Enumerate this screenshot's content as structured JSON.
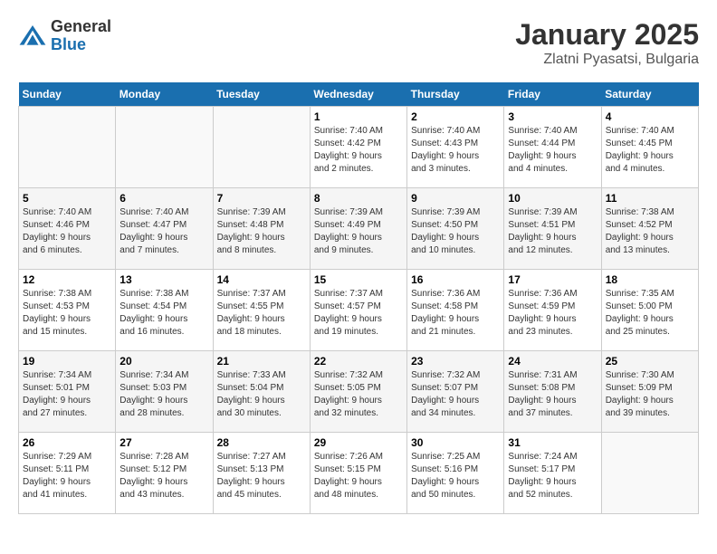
{
  "logo": {
    "general": "General",
    "blue": "Blue"
  },
  "header": {
    "month": "January 2025",
    "location": "Zlatni Pyasatsi, Bulgaria"
  },
  "weekdays": [
    "Sunday",
    "Monday",
    "Tuesday",
    "Wednesday",
    "Thursday",
    "Friday",
    "Saturday"
  ],
  "weeks": [
    [
      {
        "day": "",
        "info": ""
      },
      {
        "day": "",
        "info": ""
      },
      {
        "day": "",
        "info": ""
      },
      {
        "day": "1",
        "info": "Sunrise: 7:40 AM\nSunset: 4:42 PM\nDaylight: 9 hours\nand 2 minutes."
      },
      {
        "day": "2",
        "info": "Sunrise: 7:40 AM\nSunset: 4:43 PM\nDaylight: 9 hours\nand 3 minutes."
      },
      {
        "day": "3",
        "info": "Sunrise: 7:40 AM\nSunset: 4:44 PM\nDaylight: 9 hours\nand 4 minutes."
      },
      {
        "day": "4",
        "info": "Sunrise: 7:40 AM\nSunset: 4:45 PM\nDaylight: 9 hours\nand 4 minutes."
      }
    ],
    [
      {
        "day": "5",
        "info": "Sunrise: 7:40 AM\nSunset: 4:46 PM\nDaylight: 9 hours\nand 6 minutes."
      },
      {
        "day": "6",
        "info": "Sunrise: 7:40 AM\nSunset: 4:47 PM\nDaylight: 9 hours\nand 7 minutes."
      },
      {
        "day": "7",
        "info": "Sunrise: 7:39 AM\nSunset: 4:48 PM\nDaylight: 9 hours\nand 8 minutes."
      },
      {
        "day": "8",
        "info": "Sunrise: 7:39 AM\nSunset: 4:49 PM\nDaylight: 9 hours\nand 9 minutes."
      },
      {
        "day": "9",
        "info": "Sunrise: 7:39 AM\nSunset: 4:50 PM\nDaylight: 9 hours\nand 10 minutes."
      },
      {
        "day": "10",
        "info": "Sunrise: 7:39 AM\nSunset: 4:51 PM\nDaylight: 9 hours\nand 12 minutes."
      },
      {
        "day": "11",
        "info": "Sunrise: 7:38 AM\nSunset: 4:52 PM\nDaylight: 9 hours\nand 13 minutes."
      }
    ],
    [
      {
        "day": "12",
        "info": "Sunrise: 7:38 AM\nSunset: 4:53 PM\nDaylight: 9 hours\nand 15 minutes."
      },
      {
        "day": "13",
        "info": "Sunrise: 7:38 AM\nSunset: 4:54 PM\nDaylight: 9 hours\nand 16 minutes."
      },
      {
        "day": "14",
        "info": "Sunrise: 7:37 AM\nSunset: 4:55 PM\nDaylight: 9 hours\nand 18 minutes."
      },
      {
        "day": "15",
        "info": "Sunrise: 7:37 AM\nSunset: 4:57 PM\nDaylight: 9 hours\nand 19 minutes."
      },
      {
        "day": "16",
        "info": "Sunrise: 7:36 AM\nSunset: 4:58 PM\nDaylight: 9 hours\nand 21 minutes."
      },
      {
        "day": "17",
        "info": "Sunrise: 7:36 AM\nSunset: 4:59 PM\nDaylight: 9 hours\nand 23 minutes."
      },
      {
        "day": "18",
        "info": "Sunrise: 7:35 AM\nSunset: 5:00 PM\nDaylight: 9 hours\nand 25 minutes."
      }
    ],
    [
      {
        "day": "19",
        "info": "Sunrise: 7:34 AM\nSunset: 5:01 PM\nDaylight: 9 hours\nand 27 minutes."
      },
      {
        "day": "20",
        "info": "Sunrise: 7:34 AM\nSunset: 5:03 PM\nDaylight: 9 hours\nand 28 minutes."
      },
      {
        "day": "21",
        "info": "Sunrise: 7:33 AM\nSunset: 5:04 PM\nDaylight: 9 hours\nand 30 minutes."
      },
      {
        "day": "22",
        "info": "Sunrise: 7:32 AM\nSunset: 5:05 PM\nDaylight: 9 hours\nand 32 minutes."
      },
      {
        "day": "23",
        "info": "Sunrise: 7:32 AM\nSunset: 5:07 PM\nDaylight: 9 hours\nand 34 minutes."
      },
      {
        "day": "24",
        "info": "Sunrise: 7:31 AM\nSunset: 5:08 PM\nDaylight: 9 hours\nand 37 minutes."
      },
      {
        "day": "25",
        "info": "Sunrise: 7:30 AM\nSunset: 5:09 PM\nDaylight: 9 hours\nand 39 minutes."
      }
    ],
    [
      {
        "day": "26",
        "info": "Sunrise: 7:29 AM\nSunset: 5:11 PM\nDaylight: 9 hours\nand 41 minutes."
      },
      {
        "day": "27",
        "info": "Sunrise: 7:28 AM\nSunset: 5:12 PM\nDaylight: 9 hours\nand 43 minutes."
      },
      {
        "day": "28",
        "info": "Sunrise: 7:27 AM\nSunset: 5:13 PM\nDaylight: 9 hours\nand 45 minutes."
      },
      {
        "day": "29",
        "info": "Sunrise: 7:26 AM\nSunset: 5:15 PM\nDaylight: 9 hours\nand 48 minutes."
      },
      {
        "day": "30",
        "info": "Sunrise: 7:25 AM\nSunset: 5:16 PM\nDaylight: 9 hours\nand 50 minutes."
      },
      {
        "day": "31",
        "info": "Sunrise: 7:24 AM\nSunset: 5:17 PM\nDaylight: 9 hours\nand 52 minutes."
      },
      {
        "day": "",
        "info": ""
      }
    ]
  ]
}
